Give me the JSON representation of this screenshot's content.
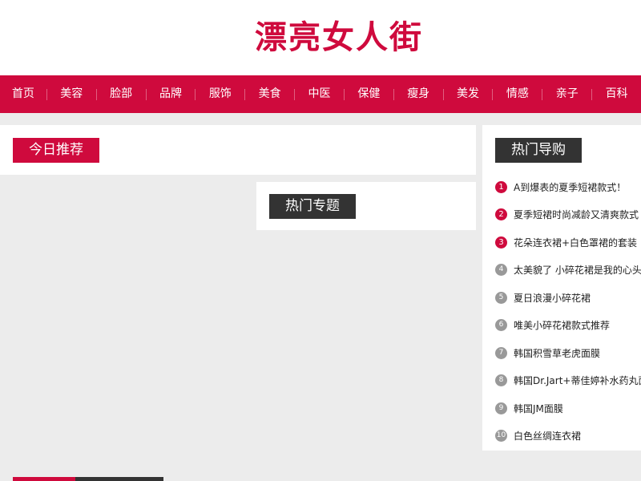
{
  "header": {
    "logo_text": "漂亮女人街"
  },
  "nav": {
    "items": [
      "首页",
      "美容",
      "脸部",
      "品牌",
      "服饰",
      "美食",
      "中医",
      "保健",
      "瘦身",
      "美发",
      "情感",
      "亲子",
      "百科"
    ]
  },
  "sections": {
    "today_title": "今日推荐",
    "topics_title": "热门专题",
    "hot_title": "热门导购"
  },
  "hot_list": [
    {
      "rank": "1",
      "text": "A到爆表的夏季短裙款式！"
    },
    {
      "rank": "2",
      "text": "夏季短裙时尚减龄又清爽款式"
    },
    {
      "rank": "3",
      "text": "花朵连衣裙+白色罩裙的套装"
    },
    {
      "rank": "4",
      "text": "太美貌了 小碎花裙是我的心头好"
    },
    {
      "rank": "5",
      "text": "夏日浪漫小碎花裙"
    },
    {
      "rank": "6",
      "text": "唯美小碎花裙款式推荐"
    },
    {
      "rank": "7",
      "text": "韩国积雪草老虎面膜"
    },
    {
      "rank": "8",
      "text": "韩国Dr.Jart+蒂佳婷补水药丸面膜"
    },
    {
      "rank": "9",
      "text": "韩国JM面膜"
    },
    {
      "rank": "10",
      "text": "白色丝绸连衣裙"
    }
  ],
  "colors": {
    "brand": "#cf0a3d",
    "dark": "#333333",
    "background": "#ececec",
    "rank_gray": "#999999"
  }
}
